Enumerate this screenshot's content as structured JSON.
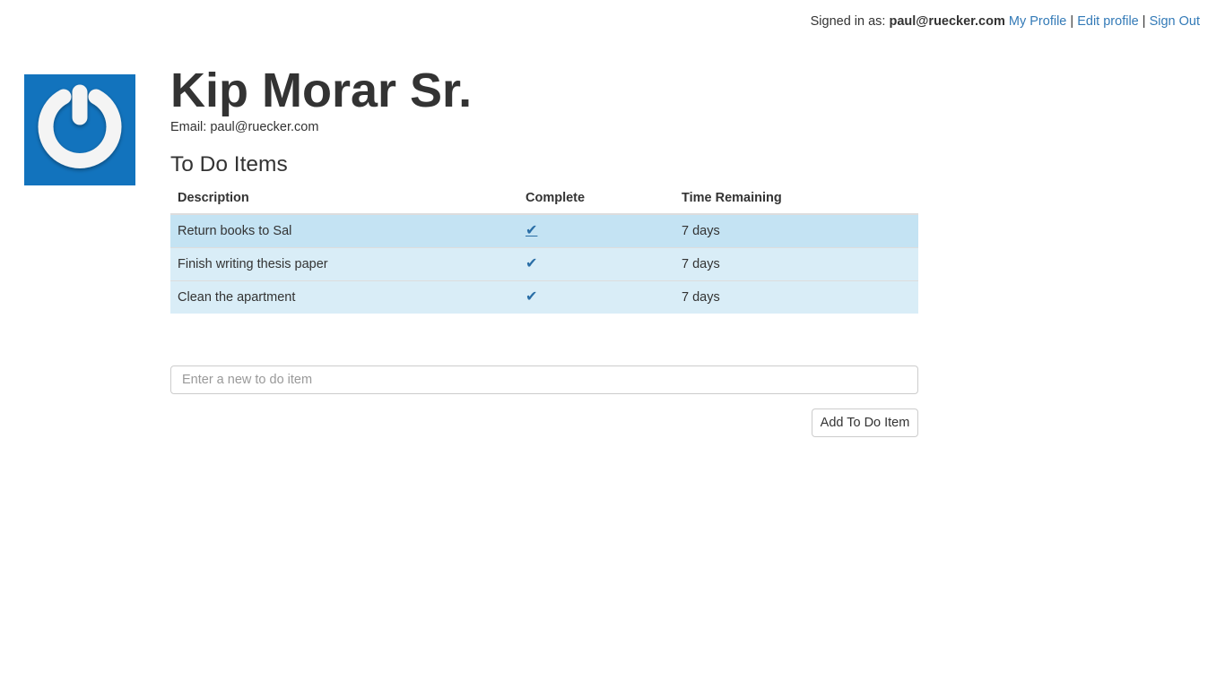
{
  "header": {
    "signed_in_label": "Signed in as:",
    "user_email": "paul@ruecker.com",
    "links": {
      "my_profile": "My Profile",
      "edit_profile": "Edit profile",
      "sign_out": "Sign Out"
    },
    "separator": "|"
  },
  "profile": {
    "avatar_icon": "power-icon",
    "avatar_color": "#1273bd",
    "name": "Kip Morar Sr.",
    "email_line": "Email: paul@ruecker.com"
  },
  "todos": {
    "title": "To Do Items",
    "columns": {
      "description": "Description",
      "complete": "Complete",
      "time_remaining": "Time Remaining"
    },
    "items": [
      {
        "description": "Return books to Sal",
        "complete": "✔",
        "time_remaining": "7 days"
      },
      {
        "description": "Finish writing thesis paper",
        "complete": "✔",
        "time_remaining": "7 days"
      },
      {
        "description": "Clean the apartment",
        "complete": "✔",
        "time_remaining": "7 days"
      }
    ],
    "row_color": "#d9edf7",
    "check_color": "#2a6ea6"
  },
  "new_item": {
    "placeholder": "Enter a new to do item",
    "value": ""
  },
  "actions": {
    "add_label": "Add To Do Item"
  }
}
